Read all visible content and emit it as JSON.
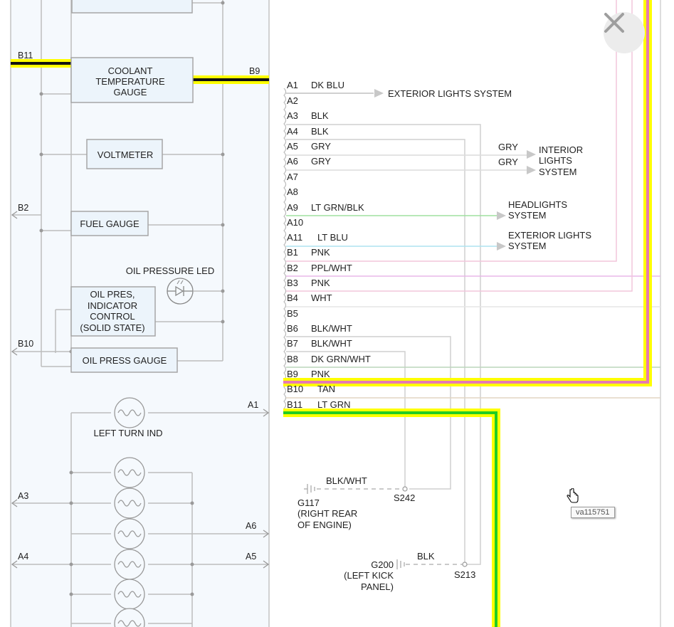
{
  "diagram": {
    "image_id": "va115751",
    "components": {
      "coolant_gauge": [
        "COOLANT",
        "TEMPERATURE",
        "GAUGE"
      ],
      "voltmeter": "VOLTMETER",
      "fuel_gauge": "FUEL GAUGE",
      "oil_pressure_led": "OIL PRESSURE LED",
      "oil_indicator": [
        "OIL PRES,",
        "INDICATOR",
        "CONTROL",
        "(SOLID STATE)"
      ],
      "oil_gauge": "OIL PRESS GAUGE",
      "left_turn": "LEFT TURN IND"
    },
    "left_refs": {
      "b11": "B11",
      "b2": "B2",
      "b10": "B10",
      "a3": "A3",
      "a4": "A4"
    },
    "inner_refs": {
      "b9": "B9",
      "a1": "A1",
      "a6": "A6",
      "a5": "A5"
    },
    "pins": [
      {
        "pin": "A1",
        "color": "DK BLU"
      },
      {
        "pin": "A2",
        "color": ""
      },
      {
        "pin": "A3",
        "color": "BLK"
      },
      {
        "pin": "A4",
        "color": "BLK"
      },
      {
        "pin": "A5",
        "color": "GRY"
      },
      {
        "pin": "A6",
        "color": "GRY"
      },
      {
        "pin": "A7",
        "color": ""
      },
      {
        "pin": "A8",
        "color": ""
      },
      {
        "pin": "A9",
        "color": "LT GRN/BLK"
      },
      {
        "pin": "A10",
        "color": ""
      },
      {
        "pin": "A11",
        "color": "LT BLU"
      },
      {
        "pin": "B1",
        "color": "PNK"
      },
      {
        "pin": "B2",
        "color": "PPL/WHT"
      },
      {
        "pin": "B3",
        "color": "PNK"
      },
      {
        "pin": "B4",
        "color": "WHT"
      },
      {
        "pin": "B5",
        "color": ""
      },
      {
        "pin": "B6",
        "color": "BLK/WHT"
      },
      {
        "pin": "B7",
        "color": "BLK/WHT"
      },
      {
        "pin": "B8",
        "color": "DK GRN/WHT"
      },
      {
        "pin": "B9",
        "color": "PNK"
      },
      {
        "pin": "B10",
        "color": "TAN"
      },
      {
        "pin": "B11",
        "color": "LT GRN"
      }
    ],
    "destinations": {
      "ext1": "EXTERIOR LIGHTS SYSTEM",
      "gry1": "GRY",
      "gry2": "GRY",
      "interior": [
        "INTERIOR",
        "LIGHTS",
        "SYSTEM"
      ],
      "headlights": [
        "HEADLIGHTS",
        "SYSTEM"
      ],
      "ext2": [
        "EXTERIOR LIGHTS",
        "SYSTEM"
      ]
    },
    "grounds": {
      "g117_wire": "BLK/WHT",
      "g117": [
        "G117",
        "(RIGHT REAR",
        "OF ENGINE)"
      ],
      "s242": "S242",
      "g200_wire": "BLK",
      "g200": [
        "G200",
        "(LEFT KICK",
        "PANEL)"
      ],
      "s213": "S213"
    }
  },
  "icons": {
    "close": "close-icon",
    "cursor": "hand-cursor-icon"
  },
  "colors": {
    "yellow": "#ffff00",
    "pink": "#e67ab3",
    "green": "#23cc23",
    "wire": "#c8c8c8"
  }
}
